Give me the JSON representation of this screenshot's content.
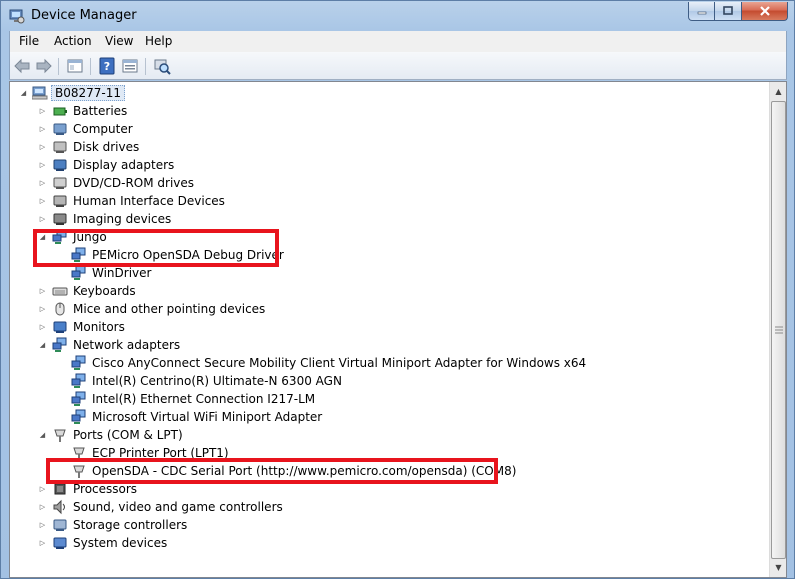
{
  "window": {
    "title": "Device Manager"
  },
  "menu": [
    "File",
    "Action",
    "View",
    "Help"
  ],
  "toolbar": {
    "buttons": [
      "back-icon",
      "forward-icon",
      "show-hide-console-tree-icon",
      "help-icon",
      "properties-icon",
      "scan-hardware-icon"
    ]
  },
  "tree": {
    "root": "B08277-11",
    "categories": [
      {
        "label": "Batteries",
        "expanded": false,
        "icon": "battery-icon"
      },
      {
        "label": "Computer",
        "expanded": false,
        "icon": "computer-icon"
      },
      {
        "label": "Disk drives",
        "expanded": false,
        "icon": "disk-drive-icon"
      },
      {
        "label": "Display adapters",
        "expanded": false,
        "icon": "display-adapter-icon"
      },
      {
        "label": "DVD/CD-ROM drives",
        "expanded": false,
        "icon": "dvd-drive-icon"
      },
      {
        "label": "Human Interface Devices",
        "expanded": false,
        "icon": "hid-icon"
      },
      {
        "label": "Imaging devices",
        "expanded": false,
        "icon": "camera-icon"
      },
      {
        "label": "Jungo",
        "expanded": true,
        "icon": "network-icon",
        "children": [
          "PEMicro OpenSDA Debug Driver",
          "WinDriver"
        ]
      },
      {
        "label": "Keyboards",
        "expanded": false,
        "icon": "keyboard-icon"
      },
      {
        "label": "Mice and other pointing devices",
        "expanded": false,
        "icon": "mouse-icon"
      },
      {
        "label": "Monitors",
        "expanded": false,
        "icon": "monitor-icon"
      },
      {
        "label": "Network adapters",
        "expanded": true,
        "icon": "network-icon",
        "children": [
          "Cisco AnyConnect Secure Mobility Client Virtual Miniport Adapter for Windows x64",
          "Intel(R) Centrino(R) Ultimate-N 6300 AGN",
          "Intel(R) Ethernet Connection I217-LM",
          "Microsoft Virtual WiFi Miniport Adapter"
        ]
      },
      {
        "label": "Ports (COM & LPT)",
        "expanded": true,
        "icon": "port-icon",
        "children": [
          "ECP Printer Port (LPT1)",
          "OpenSDA - CDC Serial Port (http://www.pemicro.com/opensda) (COM8)"
        ]
      },
      {
        "label": "Processors",
        "expanded": false,
        "icon": "processor-icon"
      },
      {
        "label": "Sound, video and game controllers",
        "expanded": false,
        "icon": "sound-icon"
      },
      {
        "label": "Storage controllers",
        "expanded": false,
        "icon": "storage-icon"
      },
      {
        "label": "System devices",
        "expanded": false,
        "icon": "system-icon"
      }
    ]
  },
  "colors": {
    "highlight": "#e8141d",
    "titlebar": "#b9d1ea"
  }
}
